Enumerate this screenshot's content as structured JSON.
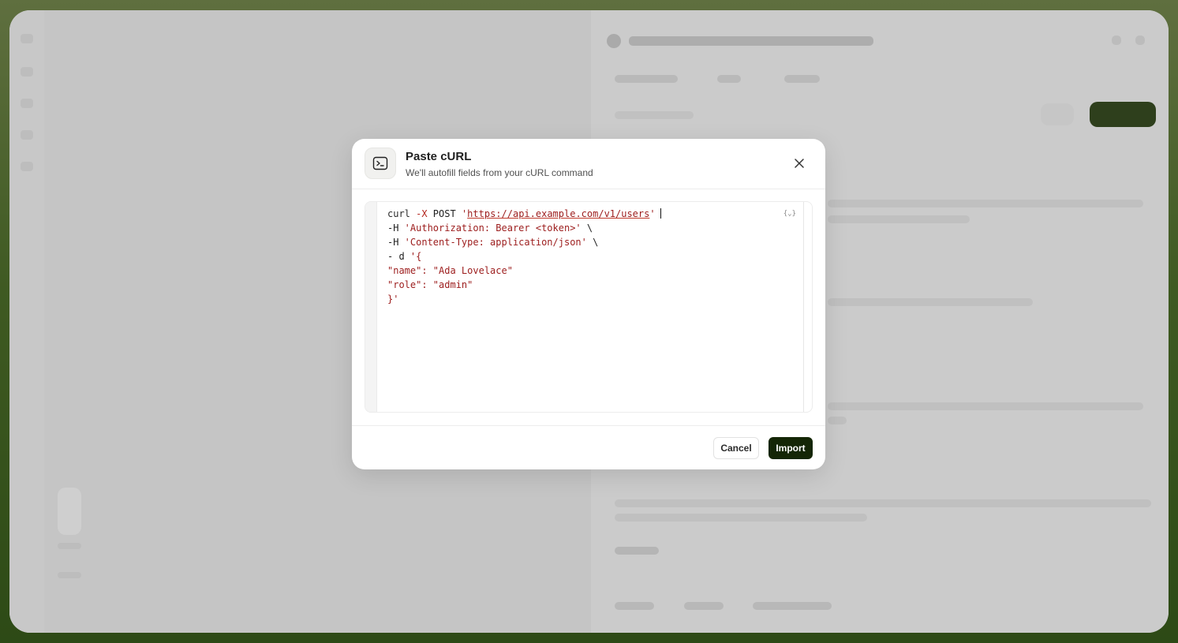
{
  "modal": {
    "title": "Paste cURL",
    "subtitle": "We'll autofill fields from your cURL command",
    "format_label": "{⌄}",
    "code": {
      "line1": {
        "cmd": "curl ",
        "flag": "-X",
        "method": " POST ",
        "q1": "'",
        "url": "https://api.example.com/v1/users",
        "q2": "'"
      },
      "line2": {
        "flag": "-H",
        "value": " 'Authorization: Bearer <token>'",
        "tail": " \\"
      },
      "line3": {
        "flag": "-H",
        "value": " 'Content-Type: application/json'",
        "tail": " \\"
      },
      "line4": {
        "flag": "- d",
        "value": " '{"
      },
      "line5": "\"name\": \"Ada Lovelace\"",
      "line6": "\"role\": \"admin\"",
      "line7": "}'"
    },
    "cancel_label": "Cancel",
    "import_label": "Import"
  },
  "colors": {
    "import_bg": "#142606",
    "code_string": "#9c1c1c",
    "backdrop_green": "#3f5a22"
  }
}
